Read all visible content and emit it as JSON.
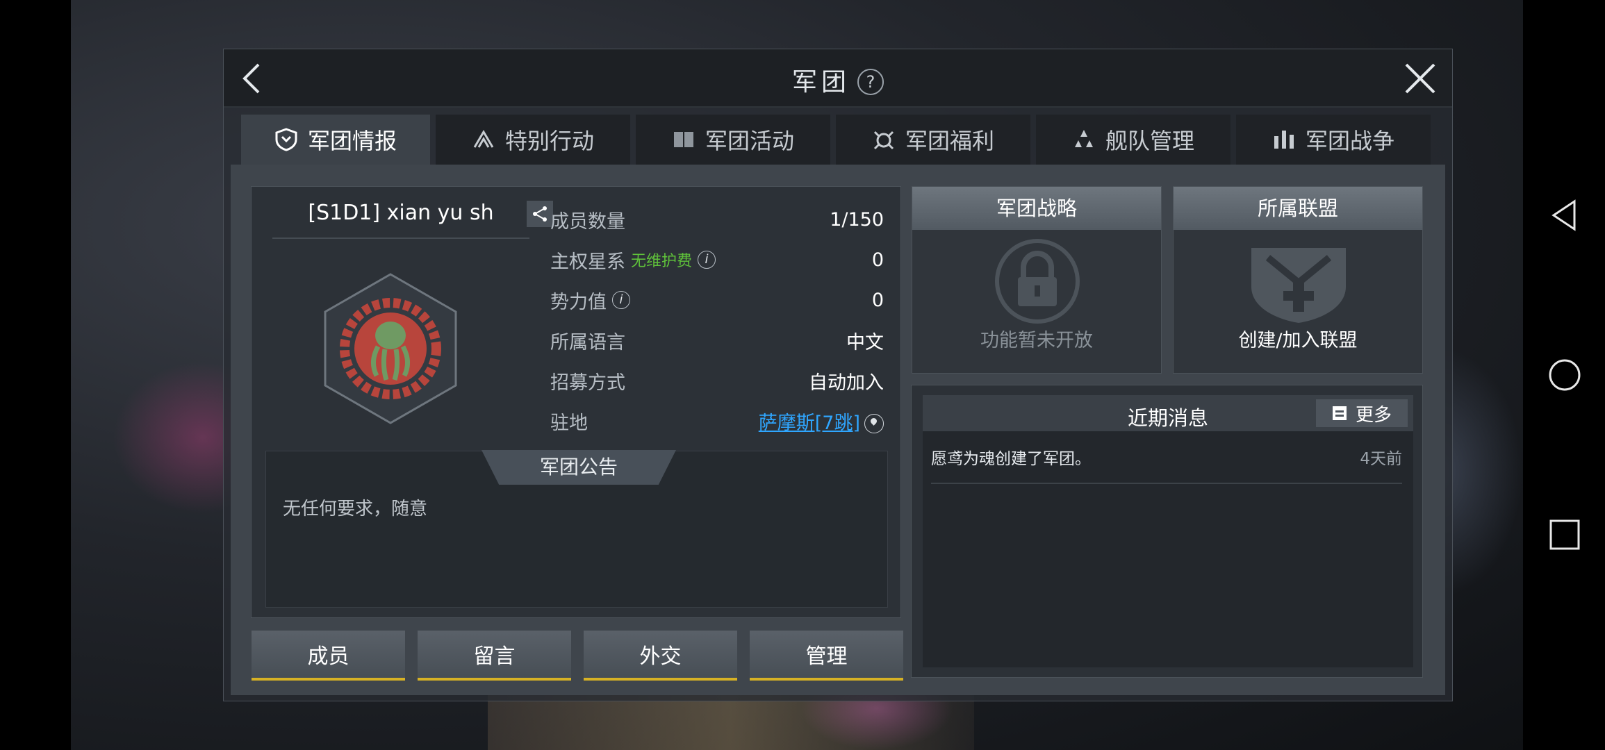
{
  "dialog": {
    "title": "军团",
    "help_icon_text": "?"
  },
  "tabs": [
    {
      "label": "军团情报",
      "icon": "shield-icon",
      "active": true
    },
    {
      "label": "特别行动",
      "icon": "chevron-up-icon",
      "active": false
    },
    {
      "label": "军团活动",
      "icon": "book-icon",
      "active": false
    },
    {
      "label": "军团福利",
      "icon": "gift-icon",
      "active": false
    },
    {
      "label": "舰队管理",
      "icon": "fleet-icon",
      "active": false
    },
    {
      "label": "军团战争",
      "icon": "war-icon",
      "active": false
    }
  ],
  "legion": {
    "name": "[S1D1] xian yu sh",
    "stats": [
      {
        "label": "成员数量",
        "value": "1/150"
      },
      {
        "label": "主权星系",
        "tag": "无维护费",
        "info": "i",
        "value": "0"
      },
      {
        "label": "势力值",
        "info": "i",
        "value": "0"
      },
      {
        "label": "所属语言",
        "value": "中文"
      },
      {
        "label": "招募方式",
        "value": "自动加入"
      },
      {
        "label": "驻地",
        "value": "萨摩斯[7跳]"
      }
    ],
    "notice_title": "军团公告",
    "notice_text": "无任何要求，随意"
  },
  "buttons": {
    "members": "成员",
    "messages": "留言",
    "diplomacy": "外交",
    "manage": "管理"
  },
  "strategy": {
    "title": "军团战略",
    "caption": "功能暂未开放"
  },
  "alliance": {
    "title": "所属联盟",
    "caption": "创建/加入联盟"
  },
  "news": {
    "title": "近期消息",
    "more": "更多",
    "items": [
      {
        "message": "愿鸢为魂创建了军团。",
        "time": "4天前"
      }
    ]
  },
  "colors": {
    "accent_yellow": "#d7b225",
    "link_blue": "#2fa6ff",
    "tag_green": "#5fc13a",
    "emblem_red": "#b8453c",
    "emblem_green": "#6f9a63"
  }
}
